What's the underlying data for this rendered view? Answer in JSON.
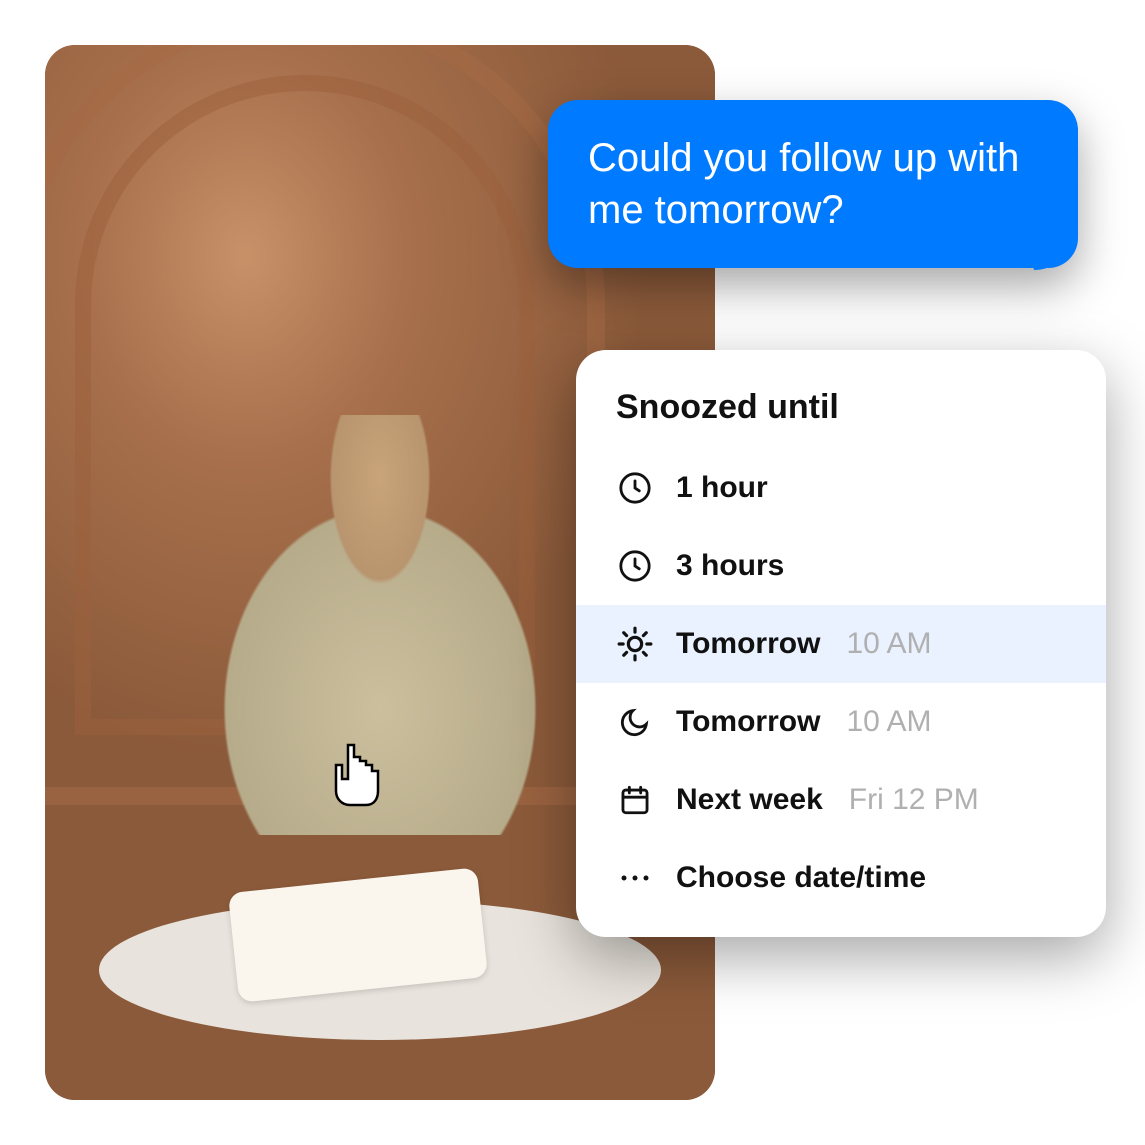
{
  "message": {
    "text": "Could you follow up with me tomorrow?"
  },
  "snooze": {
    "title": "Snoozed until",
    "options": [
      {
        "icon": "clock",
        "label": "1 hour",
        "time": ""
      },
      {
        "icon": "clock",
        "label": "3 hours",
        "time": ""
      },
      {
        "icon": "sun",
        "label": "Tomorrow",
        "time": "10 AM",
        "highlighted": true
      },
      {
        "icon": "moon",
        "label": "Tomorrow",
        "time": "10 AM"
      },
      {
        "icon": "calendar",
        "label": "Next week",
        "time": "Fri 12 PM"
      },
      {
        "icon": "dots",
        "label": "Choose date/time",
        "time": ""
      }
    ]
  }
}
